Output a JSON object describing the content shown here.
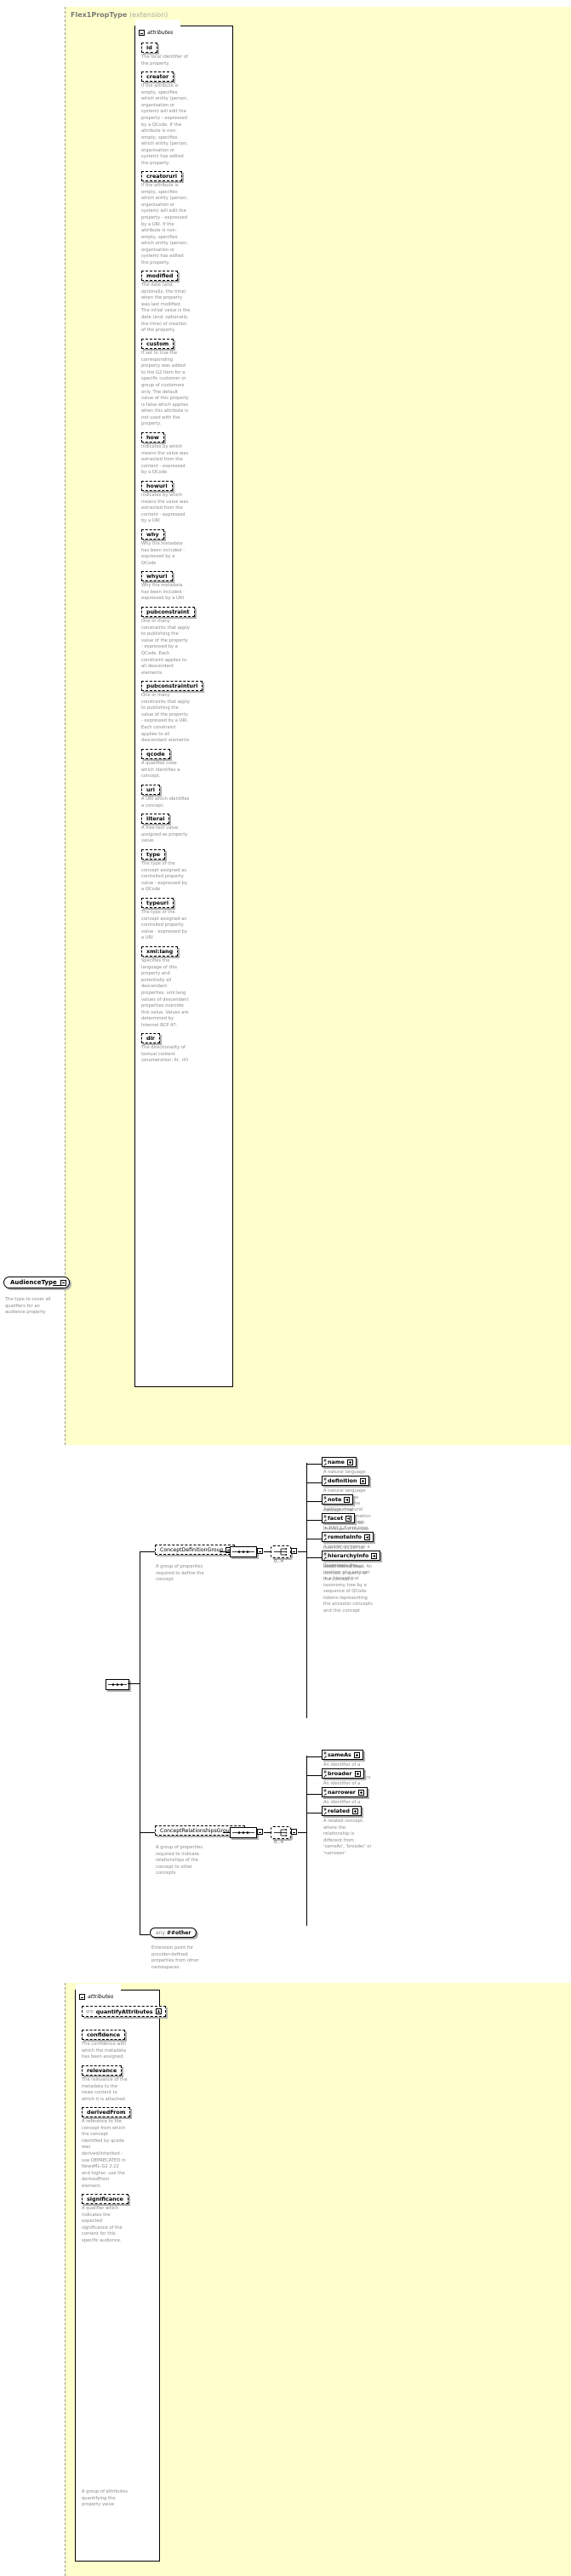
{
  "diagram": {
    "title": "Flex1PropType",
    "title_suffix": "(extension)",
    "attributes_label": "attributes",
    "any_label_prefix": "any",
    "any_label": "##other",
    "extension_note": "Extension point for provider-defined properties from other namespaces"
  },
  "type_box": {
    "name": "AudienceType",
    "description": "The type to cover all qualifiers for an audience property"
  },
  "attributes": [
    {
      "name": "id",
      "desc": "The local identifier of the property."
    },
    {
      "name": "creator",
      "desc": "If the attribute is empty, specifies which entity (person, organisation or system) will edit the property - expressed by a QCode. If the attribute is non-empty, specifies which entity (person, organisation or system) has edited the property."
    },
    {
      "name": "creatoruri",
      "desc": "If the attribute is empty, specifies which entity (person, organisation or system) will edit the property - expressed by a URI. If the attribute is non-empty, specifies which entity (person, organisation or system) has edited the property."
    },
    {
      "name": "modified",
      "desc": "The date (and, optionally, the time) when the property was last modified. The initial value is the date (and, optionally, the time) of creation of the property."
    },
    {
      "name": "custom",
      "desc": "If set to true the corresponding property was added to the G2 Item for a specific customer or group of customers only. The default value of this property is false which applies when this attribute is not used with the property."
    },
    {
      "name": "how",
      "desc": "Indicates by which means the value was extracted from the content - expressed by a QCode"
    },
    {
      "name": "howuri",
      "desc": "Indicates by which means the value was extracted from the content - expressed by a URI"
    },
    {
      "name": "why",
      "desc": "Why the metadata has been included - expressed by a QCode"
    },
    {
      "name": "whyuri",
      "desc": "Why the metadata has been included - expressed by a URI"
    },
    {
      "name": "pubconstraint",
      "desc": "One or many constraints that apply to publishing the value of the property - expressed by a QCode. Each constraint applies to all descendant elements."
    },
    {
      "name": "pubconstrainturi",
      "desc": "One or many constraints that apply to publishing the value of the property - expressed by a URI. Each constraint applies to all descendant elements."
    },
    {
      "name": "qcode",
      "desc": "A qualified code which identifies a concept."
    },
    {
      "name": "uri",
      "desc": "A URI which identifies a concept."
    },
    {
      "name": "literal",
      "desc": "A free-text value assigned as property value."
    },
    {
      "name": "type",
      "desc": "The type of the concept assigned as controlled property value - expressed by a QCode"
    },
    {
      "name": "typeuri",
      "desc": "The type of the concept assigned as controlled property value - expressed by a URI"
    },
    {
      "name": "xml:lang",
      "desc": "Specifies the language of this property and potentially all descendant properties. xml:lang values of descendant properties override this value. Values are determined by Internet BCP 47."
    },
    {
      "name": "dir",
      "desc": "The directionality of textual content (enumeration: ltr, rtl)"
    }
  ],
  "groups": [
    {
      "name": "ConceptDefinitionGroup",
      "desc": "A group of properites required to define the concept",
      "cardinality": "0..∞",
      "children": [
        {
          "name": "name",
          "desc": "A natural language name for the concept."
        },
        {
          "name": "definition",
          "desc": "A natural language definition of the semantics of the concept. This definition is normative only for the scope of the use of this concept."
        },
        {
          "name": "note",
          "desc": "Additional natural language information about the concept."
        },
        {
          "name": "facet",
          "desc": "In NAR 1.8 and later, facet is deprecated and SHOULD NOT (see RFC 2119) be used, the \"related\" property should be used instead (was: An intrinsic property of the concept.)"
        },
        {
          "name": "remoteInfo",
          "desc": "A link to an item or a web resource which provides information about the concept"
        },
        {
          "name": "hierarchyInfo",
          "desc": "Represents the position of a concept in a hierarchical taxonomy tree by a sequence of QCode tokens representing the ancestor concepts and this concept"
        }
      ]
    },
    {
      "name": "ConceptRelationshipsGroup",
      "desc": "A group of properties required to indicate relationships of the concept to other concepts",
      "cardinality": "0..∞",
      "children": [
        {
          "name": "sameAs",
          "desc": "An identifier of a concept with equivalent semantics"
        },
        {
          "name": "broader",
          "desc": "An identifier of a more generic concept."
        },
        {
          "name": "narrower",
          "desc": "An identifier of a more specific concept."
        },
        {
          "name": "related",
          "desc": "A related concept, where the relationship is different from 'sameAs', 'broader' or 'narrower'."
        }
      ]
    }
  ],
  "second_panel": {
    "attributes_label": "attributes",
    "group_ref": {
      "prefix": "grp",
      "name": "quantifyAttributes",
      "desc": "A group of attributes quantifying the property value"
    },
    "attributes": [
      {
        "name": "confidence",
        "desc": "The confidence with which the metadata has been assigned."
      },
      {
        "name": "relevance",
        "desc": "The relevance of the metadata to the news content to which it is attached."
      },
      {
        "name": "derivedFrom",
        "desc": "A reference to the concept from which the concept identified by qcode was derived/inherited - use DEPRECATED in NewsML-G2 2.22 and higher, use the derivedFrom element."
      },
      {
        "name": "significance",
        "desc": "A qualifier which indicates the expected significance of the content for this specific audience."
      }
    ]
  }
}
